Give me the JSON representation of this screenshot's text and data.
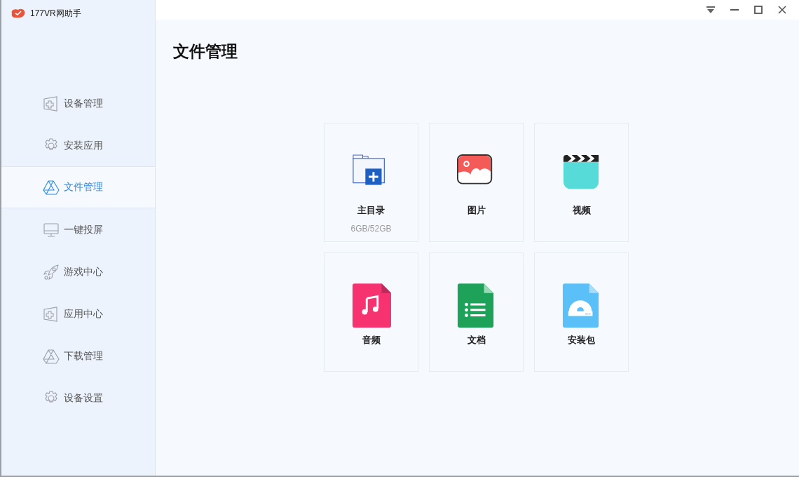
{
  "window": {
    "title": "177VR网助手"
  },
  "sidebar": {
    "items": [
      {
        "label": "设备管理",
        "kind": "window",
        "selected": false
      },
      {
        "label": "安装应用",
        "kind": "gear",
        "selected": false
      },
      {
        "label": "文件管理",
        "kind": "drive",
        "selected": true
      },
      {
        "label": "一键投屏",
        "kind": "monitor",
        "selected": false
      },
      {
        "label": "游戏中心",
        "kind": "rocket",
        "selected": false
      },
      {
        "label": "应用中心",
        "kind": "window",
        "selected": false
      },
      {
        "label": "下载管理",
        "kind": "drive",
        "selected": false
      },
      {
        "label": "设备设置",
        "kind": "gear",
        "selected": false
      }
    ]
  },
  "page": {
    "title": "文件管理"
  },
  "tiles": [
    {
      "label": "主目录",
      "kind": "folder",
      "detail": "6GB/52GB"
    },
    {
      "label": "图片",
      "kind": "picture"
    },
    {
      "label": "视频",
      "kind": "video"
    },
    {
      "label": "音频",
      "kind": "audio"
    },
    {
      "label": "文档",
      "kind": "document"
    },
    {
      "label": "安装包",
      "kind": "package"
    }
  ]
}
